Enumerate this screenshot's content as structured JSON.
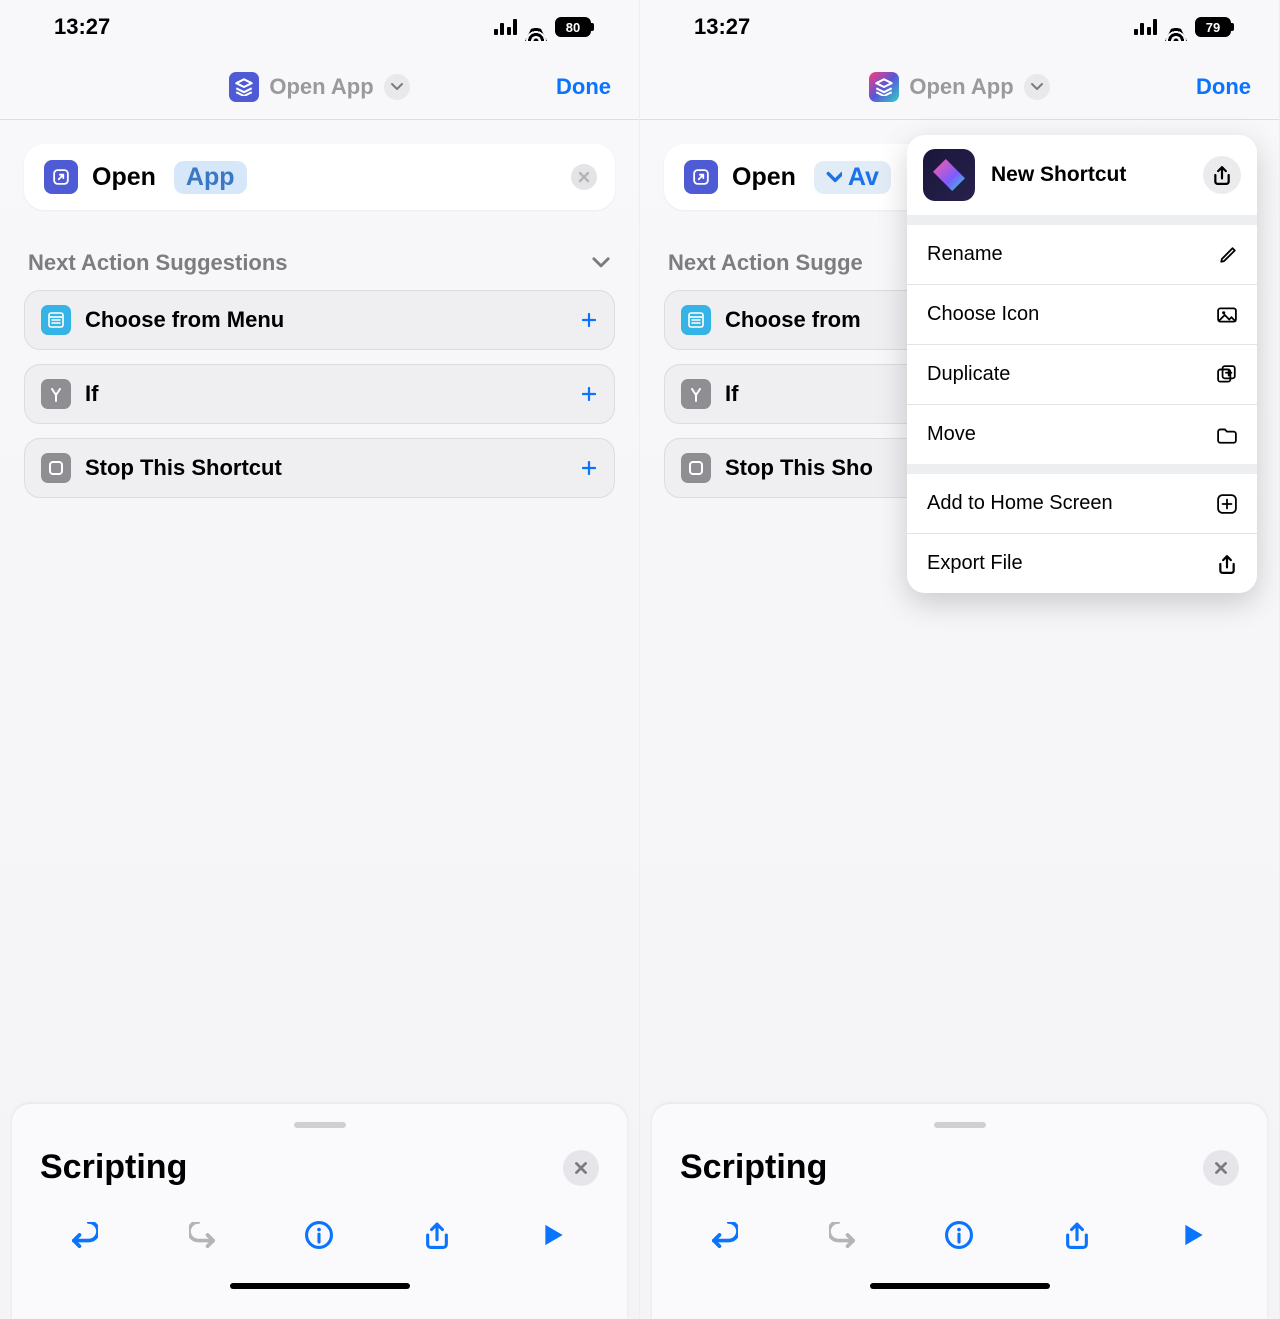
{
  "left": {
    "status": {
      "time": "13:27",
      "battery": "80"
    },
    "title": {
      "label": "Open App",
      "done": "Done"
    },
    "action": {
      "verb": "Open",
      "param": "App"
    },
    "sugg_header": "Next Action Suggestions",
    "sugg": [
      {
        "label": "Choose from Menu"
      },
      {
        "label": "If"
      },
      {
        "label": "Stop This Shortcut"
      }
    ],
    "panel_title": "Scripting"
  },
  "right": {
    "status": {
      "time": "13:27",
      "battery": "79"
    },
    "title": {
      "label": "Open App",
      "done": "Done"
    },
    "action": {
      "verb": "Open",
      "param": "Av"
    },
    "sugg_header": "Next Action Sugge",
    "sugg": [
      {
        "label": "Choose from"
      },
      {
        "label": "If"
      },
      {
        "label": "Stop This Sho"
      }
    ],
    "panel_title": "Scripting",
    "popover": {
      "head": "New Shortcut",
      "rows1": [
        {
          "label": "Rename",
          "icon": "pencil"
        },
        {
          "label": "Choose Icon",
          "icon": "photo"
        },
        {
          "label": "Duplicate",
          "icon": "dup"
        },
        {
          "label": "Move",
          "icon": "folder"
        }
      ],
      "rows2": [
        {
          "label": "Add to Home Screen",
          "icon": "plusbox"
        },
        {
          "label": "Export File",
          "icon": "share"
        }
      ]
    }
  }
}
